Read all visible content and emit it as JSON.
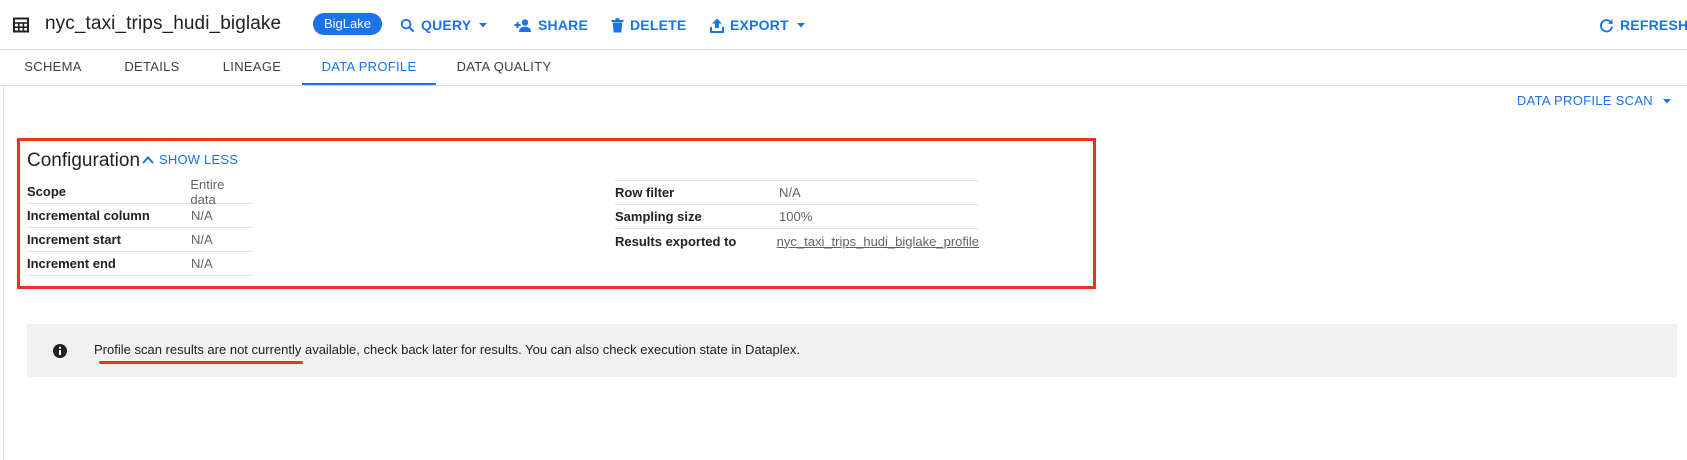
{
  "header": {
    "title": "nyc_taxi_trips_hudi_biglake",
    "badge": "BigLake",
    "actions": {
      "query": "QUERY",
      "share": "SHARE",
      "delete": "DELETE",
      "export": "EXPORT",
      "refresh": "REFRESH"
    }
  },
  "tabs": [
    "SCHEMA",
    "DETAILS",
    "LINEAGE",
    "DATA PROFILE",
    "DATA QUALITY"
  ],
  "active_tab": "DATA PROFILE",
  "scan_menu": {
    "label": "DATA PROFILE SCAN"
  },
  "configuration": {
    "title": "Configuration",
    "toggle_label": "SHOW LESS",
    "left": [
      {
        "key": "Scope",
        "value": "Entire data"
      },
      {
        "key": "Incremental column",
        "value": "N/A"
      },
      {
        "key": "Increment start",
        "value": "N/A"
      },
      {
        "key": "Increment end",
        "value": "N/A"
      }
    ],
    "right": [
      {
        "key": "Row filter",
        "value": "N/A"
      },
      {
        "key": "Sampling size",
        "value": "100%"
      },
      {
        "key": "Results exported to",
        "value": "nyc_taxi_trips_hudi_biglake_profile"
      }
    ]
  },
  "notice": {
    "text": "Profile scan results are not currently available, check back later for results. You can also check execution state in Dataplex."
  },
  "colors": {
    "accent": "#1a73e8",
    "highlight": "#ea3323",
    "banner_bg": "#f1f1f1"
  },
  "icons": {
    "table": "table-icon",
    "query": "search-icon",
    "share": "person-add-icon",
    "delete": "trash-icon",
    "export": "upload-icon",
    "refresh": "refresh-icon",
    "info": "info-icon"
  }
}
